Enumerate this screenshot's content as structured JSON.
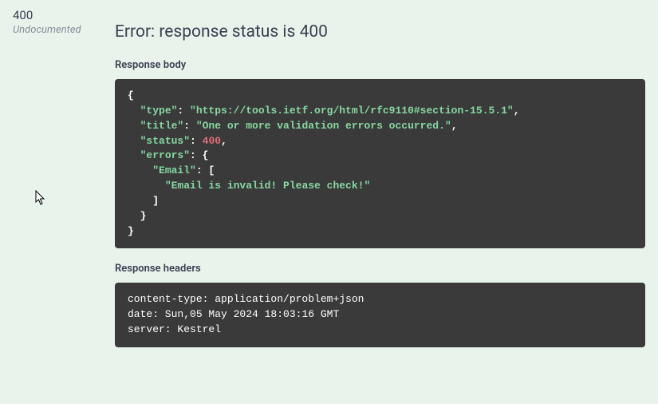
{
  "status": {
    "code": "400",
    "undocumented": "Undocumented"
  },
  "error_title": "Error: response status is 400",
  "labels": {
    "body": "Response body",
    "headers": "Response headers"
  },
  "body_json": {
    "type_key": "\"type\"",
    "type_val": "\"https://tools.ietf.org/html/rfc9110#section-15.5.1\"",
    "title_key": "\"title\"",
    "title_val": "\"One or more validation errors occurred.\"",
    "status_key": "\"status\"",
    "status_val": "400",
    "errors_key": "\"errors\"",
    "email_key": "\"Email\"",
    "email_msg": "\"Email is invalid! Please check!\""
  },
  "headers": {
    "content_type": "content-type: application/problem+json",
    "date": "date: Sun,05 May 2024 18:03:16 GMT",
    "server": "server: Kestrel"
  }
}
